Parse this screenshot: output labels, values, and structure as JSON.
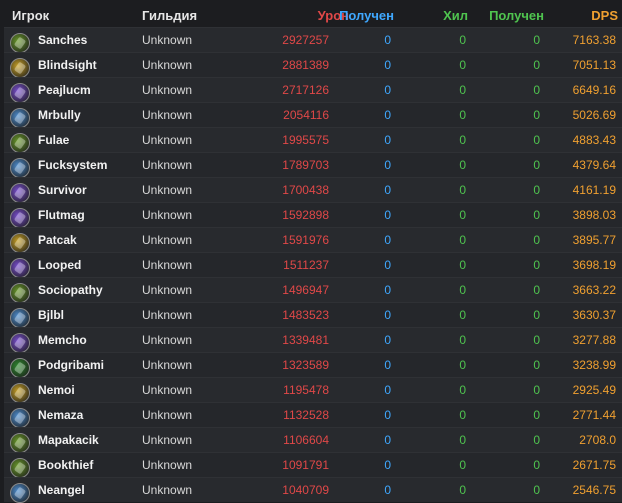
{
  "header": {
    "player": "Игрок",
    "guild": "Гильдия",
    "damage": "Урон",
    "received": "Получен",
    "heal": "Хил",
    "heal_received": "Получен",
    "dps": "DPS"
  },
  "colors": {
    "damage": "#e04848",
    "received": "#3fa8ff",
    "heal": "#4fc44f",
    "dps": "#f0a030"
  },
  "rows": [
    {
      "name": "Sanches",
      "guild": "Unknown",
      "damage": "2927257",
      "received": "0",
      "heal": "0",
      "heal_received": "0",
      "dps": "7163.38",
      "icon": "hunter-class-icon",
      "icon_color": "#6a9a2a"
    },
    {
      "name": "Blindsight",
      "guild": "Unknown",
      "damage": "2881389",
      "received": "0",
      "heal": "0",
      "heal_received": "0",
      "dps": "7051.13",
      "icon": "rogue-class-icon",
      "icon_color": "#c9a227"
    },
    {
      "name": "Peajlucm",
      "guild": "Unknown",
      "damage": "2717126",
      "received": "0",
      "heal": "0",
      "heal_received": "0",
      "dps": "6649.16",
      "icon": "warlock-class-icon",
      "icon_color": "#7a4fd1"
    },
    {
      "name": "Mrbully",
      "guild": "Unknown",
      "damage": "2054116",
      "received": "0",
      "heal": "0",
      "heal_received": "0",
      "dps": "5026.69",
      "icon": "mage-class-icon",
      "icon_color": "#4f8fd1"
    },
    {
      "name": "Fulae",
      "guild": "Unknown",
      "damage": "1995575",
      "received": "0",
      "heal": "0",
      "heal_received": "0",
      "dps": "4883.43",
      "icon": "hunter-class-icon",
      "icon_color": "#6a9a2a"
    },
    {
      "name": "Fucksystem",
      "guild": "Unknown",
      "damage": "1789703",
      "received": "0",
      "heal": "0",
      "heal_received": "0",
      "dps": "4379.64",
      "icon": "mage-class-icon",
      "icon_color": "#4f8fd1"
    },
    {
      "name": "Survivor",
      "guild": "Unknown",
      "damage": "1700438",
      "received": "0",
      "heal": "0",
      "heal_received": "0",
      "dps": "4161.19",
      "icon": "warlock-class-icon",
      "icon_color": "#7a4fd1"
    },
    {
      "name": "Flutmag",
      "guild": "Unknown",
      "damage": "1592898",
      "received": "0",
      "heal": "0",
      "heal_received": "0",
      "dps": "3898.03",
      "icon": "warlock-class-icon",
      "icon_color": "#7a4fd1"
    },
    {
      "name": "Patcak",
      "guild": "Unknown",
      "damage": "1591976",
      "received": "0",
      "heal": "0",
      "heal_received": "0",
      "dps": "3895.77",
      "icon": "rogue-class-icon",
      "icon_color": "#c9a227"
    },
    {
      "name": "Looped",
      "guild": "Unknown",
      "damage": "1511237",
      "received": "0",
      "heal": "0",
      "heal_received": "0",
      "dps": "3698.19",
      "icon": "warlock-class-icon",
      "icon_color": "#7a4fd1"
    },
    {
      "name": "Sociopathy",
      "guild": "Unknown",
      "damage": "1496947",
      "received": "0",
      "heal": "0",
      "heal_received": "0",
      "dps": "3663.22",
      "icon": "hunter-class-icon",
      "icon_color": "#6a9a2a"
    },
    {
      "name": "Bjlbl",
      "guild": "Unknown",
      "damage": "1483523",
      "received": "0",
      "heal": "0",
      "heal_received": "0",
      "dps": "3630.37",
      "icon": "mage-class-icon",
      "icon_color": "#4f8fd1"
    },
    {
      "name": "Memcho",
      "guild": "Unknown",
      "damage": "1339481",
      "received": "0",
      "heal": "0",
      "heal_received": "0",
      "dps": "3277.88",
      "icon": "warlock-class-icon",
      "icon_color": "#7a4fd1"
    },
    {
      "name": "Podgribami",
      "guild": "Unknown",
      "damage": "1323589",
      "received": "0",
      "heal": "0",
      "heal_received": "0",
      "dps": "3238.99",
      "icon": "druid-class-icon",
      "icon_color": "#2e8a2e"
    },
    {
      "name": "Nemoi",
      "guild": "Unknown",
      "damage": "1195478",
      "received": "0",
      "heal": "0",
      "heal_received": "0",
      "dps": "2925.49",
      "icon": "rogue-class-icon",
      "icon_color": "#c9a227"
    },
    {
      "name": "Nemaza",
      "guild": "Unknown",
      "damage": "1132528",
      "received": "0",
      "heal": "0",
      "heal_received": "0",
      "dps": "2771.44",
      "icon": "mage-class-icon",
      "icon_color": "#4f8fd1"
    },
    {
      "name": "Mapakacik",
      "guild": "Unknown",
      "damage": "1106604",
      "received": "0",
      "heal": "0",
      "heal_received": "0",
      "dps": "2708.0",
      "icon": "hunter-class-icon",
      "icon_color": "#6a9a2a"
    },
    {
      "name": "Bookthief",
      "guild": "Unknown",
      "damage": "1091791",
      "received": "0",
      "heal": "0",
      "heal_received": "0",
      "dps": "2671.75",
      "icon": "hunter-class-icon",
      "icon_color": "#6a9a2a"
    },
    {
      "name": "Neangel",
      "guild": "Unknown",
      "damage": "1040709",
      "received": "0",
      "heal": "0",
      "heal_received": "0",
      "dps": "2546.75",
      "icon": "mage-class-icon",
      "icon_color": "#4f8fd1"
    }
  ]
}
